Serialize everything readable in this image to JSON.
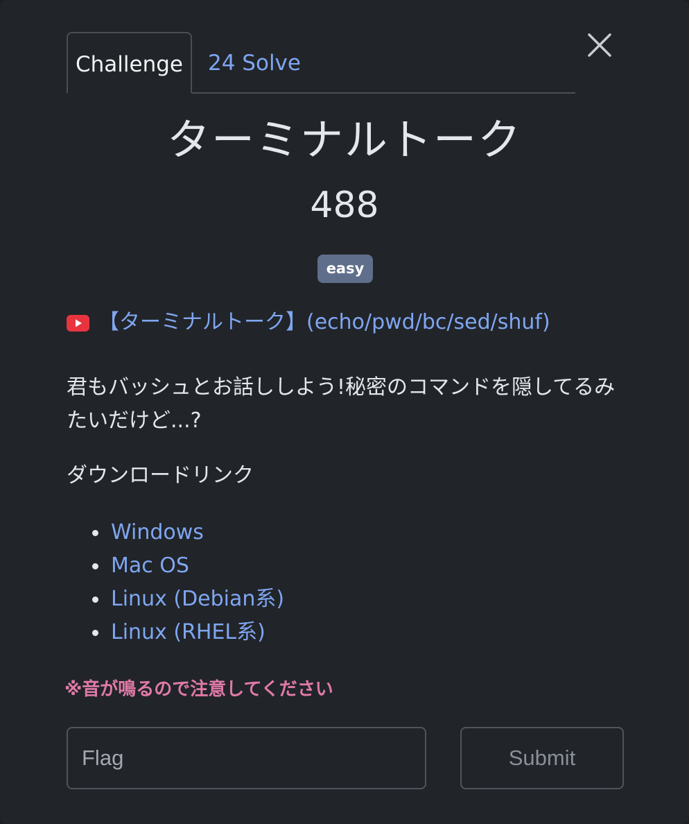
{
  "tabs": [
    {
      "label": "Challenge",
      "active": true
    },
    {
      "label": "24 Solve",
      "active": false
    }
  ],
  "challenge": {
    "title": "ターミナルトーク",
    "points": "488",
    "difficulty": "easy",
    "video_link_text": "【ターミナルトーク】(echo/pwd/bc/sed/shuf)",
    "video_icon": "youtube-icon",
    "description": "君もバッシュとお話ししよう!秘密のコマンドを隠してるみたいだけど...?",
    "download_heading": "ダウンロードリンク",
    "downloads": [
      {
        "label": "Windows"
      },
      {
        "label": "Mac OS"
      },
      {
        "label": "Linux (Debian系)"
      },
      {
        "label": "Linux (RHEL系)"
      }
    ],
    "warning": "※音が鳴るので注意してください"
  },
  "form": {
    "flag_placeholder": "Flag",
    "submit_label": "Submit"
  },
  "colors": {
    "background": "#212429",
    "link": "#7fa6f0",
    "badge": "#5f6e8a",
    "warning": "#e07aa8",
    "youtube": "#e8343f"
  }
}
